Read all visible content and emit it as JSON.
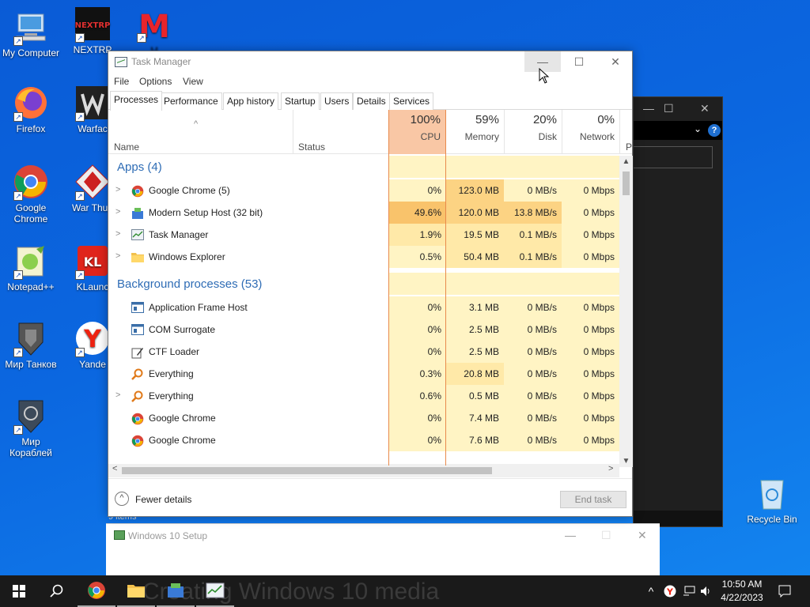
{
  "desktop": {
    "icons": [
      {
        "label": "My Computer"
      },
      {
        "label": "NEXTRP"
      },
      {
        "label": "M"
      },
      {
        "label": "Firefox"
      },
      {
        "label": "Warfac"
      },
      {
        "label": "Google Chrome"
      },
      {
        "label": "War Thun"
      },
      {
        "label": "Notepad++"
      },
      {
        "label": "KLaunc"
      },
      {
        "label": "Мир Танков"
      },
      {
        "label": "Yande"
      },
      {
        "label": "Мир Кораблей"
      }
    ],
    "recycle_bin": "Recycle Bin"
  },
  "task_manager": {
    "title": "Task Manager",
    "menu": [
      "File",
      "Options",
      "View"
    ],
    "tabs": [
      "Processes",
      "Performance",
      "App history",
      "Startup",
      "Users",
      "Details",
      "Services"
    ],
    "active_tab": "Processes",
    "columns": {
      "name": "Name",
      "status": "Status",
      "cpu": {
        "percent": "100%",
        "label": "CPU"
      },
      "memory": {
        "percent": "59%",
        "label": "Memory"
      },
      "disk": {
        "percent": "20%",
        "label": "Disk"
      },
      "network": {
        "percent": "0%",
        "label": "Network"
      },
      "extra": "P"
    },
    "groups": [
      {
        "label": "Apps (4)"
      },
      {
        "label": "Background processes (53)"
      }
    ],
    "apps": [
      {
        "name": "Google Chrome (5)",
        "icon": "chrome-icon",
        "expandable": true,
        "cpu": "0%",
        "memory": "123.0 MB",
        "disk": "0 MB/s",
        "network": "0 Mbps"
      },
      {
        "name": "Modern Setup Host (32 bit)",
        "icon": "setup-icon",
        "expandable": true,
        "cpu": "49.6%",
        "memory": "120.0 MB",
        "disk": "13.8 MB/s",
        "network": "0 Mbps"
      },
      {
        "name": "Task Manager",
        "icon": "taskmgr-icon",
        "expandable": true,
        "cpu": "1.9%",
        "memory": "19.5 MB",
        "disk": "0.1 MB/s",
        "network": "0 Mbps"
      },
      {
        "name": "Windows Explorer",
        "icon": "folder-icon",
        "expandable": true,
        "cpu": "0.5%",
        "memory": "50.4 MB",
        "disk": "0.1 MB/s",
        "network": "0 Mbps"
      }
    ],
    "background": [
      {
        "name": "Application Frame Host",
        "icon": "window-icon",
        "expandable": false,
        "cpu": "0%",
        "memory": "3.1 MB",
        "disk": "0 MB/s",
        "network": "0 Mbps"
      },
      {
        "name": "COM Surrogate",
        "icon": "window-icon",
        "expandable": false,
        "cpu": "0%",
        "memory": "2.5 MB",
        "disk": "0 MB/s",
        "network": "0 Mbps"
      },
      {
        "name": "CTF Loader",
        "icon": "pen-icon",
        "expandable": false,
        "cpu": "0%",
        "memory": "2.5 MB",
        "disk": "0 MB/s",
        "network": "0 Mbps"
      },
      {
        "name": "Everything",
        "icon": "magnifier-icon",
        "expandable": false,
        "cpu": "0.3%",
        "memory": "20.8 MB",
        "disk": "0 MB/s",
        "network": "0 Mbps"
      },
      {
        "name": "Everything",
        "icon": "magnifier-icon",
        "expandable": true,
        "cpu": "0.6%",
        "memory": "0.5 MB",
        "disk": "0 MB/s",
        "network": "0 Mbps"
      },
      {
        "name": "Google Chrome",
        "icon": "chrome-icon",
        "expandable": false,
        "cpu": "0%",
        "memory": "7.4 MB",
        "disk": "0 MB/s",
        "network": "0 Mbps"
      },
      {
        "name": "Google Chrome",
        "icon": "chrome-icon",
        "expandable": false,
        "cpu": "0%",
        "memory": "7.6 MB",
        "disk": "0 MB/s",
        "network": "0 Mbps"
      }
    ],
    "fewer_details": "Fewer details",
    "end_task": "End task"
  },
  "setup_window": {
    "title": "Windows 10 Setup",
    "behind_text": "Creating Windows 10 media"
  },
  "explorer_status": "9 items",
  "taskbar": {
    "time": "10:50 AM",
    "date": "4/22/2023"
  },
  "colors": {
    "cpu_header": "#f9c7a5",
    "accent_blue": "#2e6cb5",
    "heat_low": "#fff4c4",
    "heat_high": "#f9c36b"
  }
}
